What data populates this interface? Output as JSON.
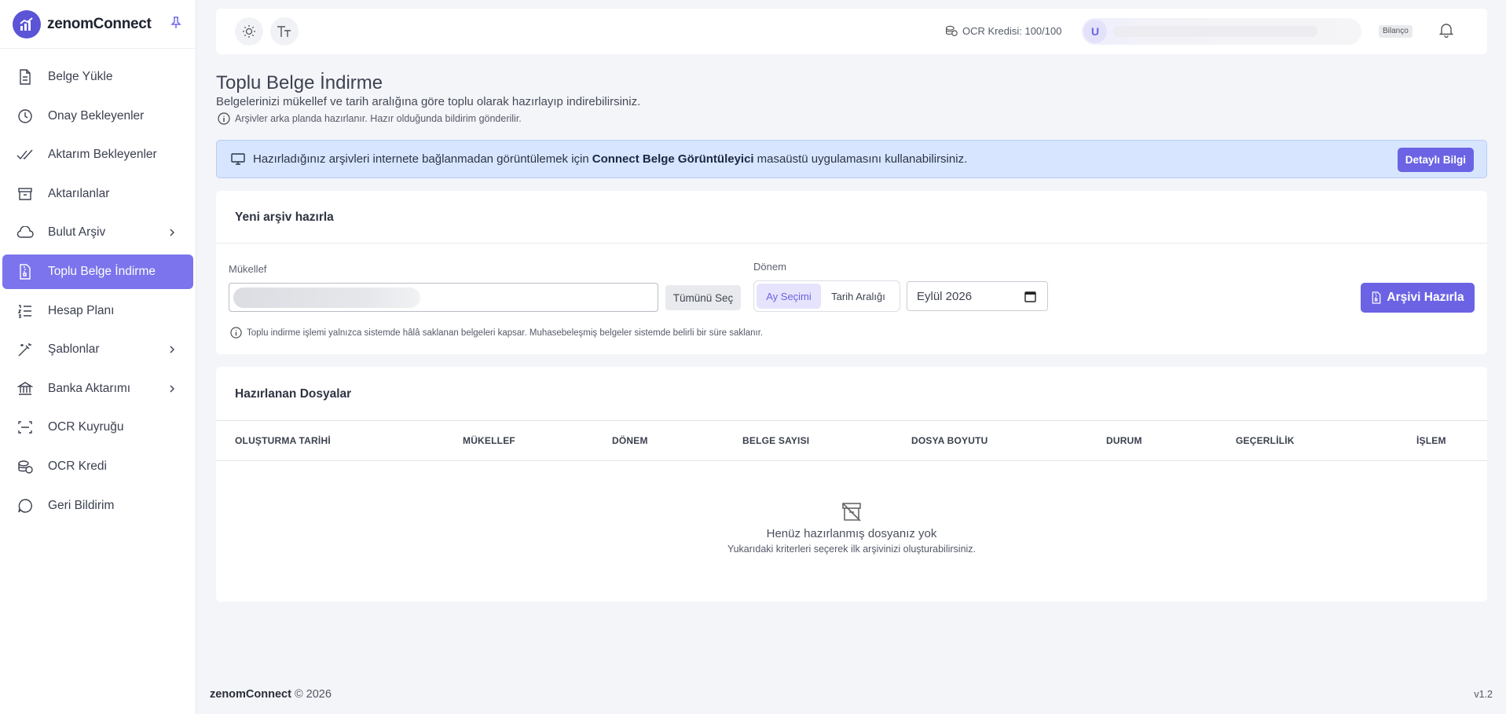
{
  "brand": {
    "name": "zenomConnect",
    "logo_icon": "chart-logo-icon",
    "pin_icon": "pin-icon"
  },
  "sidebar": {
    "items": [
      {
        "label": "Belge Yükle",
        "icon": "file-upload-icon",
        "has_chevron": false
      },
      {
        "label": "Onay Bekleyenler",
        "icon": "clock-icon",
        "has_chevron": false
      },
      {
        "label": "Aktarım Bekleyenler",
        "icon": "double-check-icon",
        "has_chevron": false
      },
      {
        "label": "Aktarılanlar",
        "icon": "archive-box-icon",
        "has_chevron": false
      },
      {
        "label": "Bulut Arşiv",
        "icon": "cloud-icon",
        "has_chevron": true
      },
      {
        "label": "Toplu Belge İndirme",
        "icon": "file-zip-icon",
        "has_chevron": false,
        "active": true
      },
      {
        "label": "Hesap Planı",
        "icon": "list-numbers-icon",
        "has_chevron": false
      },
      {
        "label": "Şablonlar",
        "icon": "magic-wand-icon",
        "has_chevron": true
      },
      {
        "label": "Banka Aktarımı",
        "icon": "bank-icon",
        "has_chevron": true
      },
      {
        "label": "OCR Kuyruğu",
        "icon": "scan-icon",
        "has_chevron": false
      },
      {
        "label": "OCR Kredi",
        "icon": "coins-icon",
        "has_chevron": false
      },
      {
        "label": "Geri Bildirim",
        "icon": "chat-bubble-icon",
        "has_chevron": false
      }
    ]
  },
  "topbar": {
    "ocr_credit": "OCR Kredisi: 100/100",
    "user_initial": "U",
    "plan_tag": "Bilanço",
    "icons": [
      "sun-icon",
      "text-size-icon",
      "coins-icon",
      "bell-icon"
    ]
  },
  "page": {
    "title": "Toplu Belge İndirme",
    "subtitle": "Belgelerinizi mükellef ve tarih aralığına göre toplu olarak hazırlayıp indirebilirsiniz.",
    "note": "Arşivler arka planda hazırlanır. Hazır olduğunda bildirim gönderilir."
  },
  "banner": {
    "text_before": "Hazırladığınız arşivleri internete bağlanmadan görüntülemek için",
    "app_name": "Connect Belge Görüntüleyici",
    "text_after": "masaüstü uygulamasını kullanabilirsiniz.",
    "button": "Detaylı Bilgi",
    "color": "#d7e5fe"
  },
  "new_archive": {
    "title": "Yeni arşiv hazırla",
    "mukellef_label": "Mükellef",
    "select_all": "Tümünü Seç",
    "donem_label": "Dönem",
    "period_options": [
      "Ay Seçimi",
      "Tarih Aralığı"
    ],
    "period_selected": "Ay Seçimi",
    "month_value": "Eylül 2026",
    "submit": "Arşivi Hazırla",
    "note": "Toplu indirme işlemi yalnızca sistemde hâlâ saklanan belgeleri kapsar. Muhasebeleşmiş belgeler sistemde belirli bir süre saklanır."
  },
  "prepared_files": {
    "title": "Hazırlanan Dosyalar",
    "columns": [
      "OLUŞTURMA TARİHİ",
      "MÜKELLEF",
      "DÖNEM",
      "BELGE SAYISI",
      "DOSYA BOYUTU",
      "DURUM",
      "GEÇERLİLİK",
      "İŞLEM"
    ],
    "rows": [],
    "empty_title": "Henüz hazırlanmış dosyanız yok",
    "empty_subtitle": "Yukarıdaki kriterleri seçerek ilk arşivinizi oluşturabilirsiniz."
  },
  "footer": {
    "brand": "zenomConnect",
    "copyright": "© 2026",
    "version": "v1.2"
  },
  "colors": {
    "accent": "#6b63e4",
    "active_nav": "#7b74ec",
    "background": "#f4f5f9"
  }
}
